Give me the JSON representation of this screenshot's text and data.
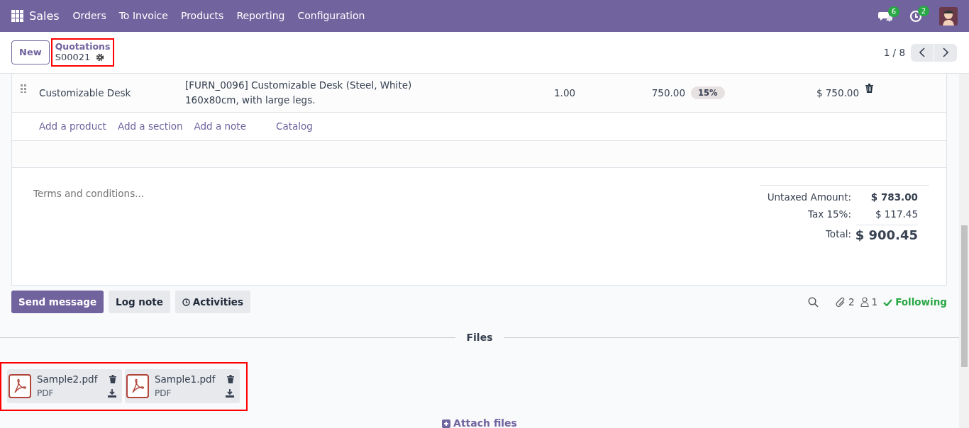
{
  "navbar": {
    "app": "Sales",
    "menus": [
      "Orders",
      "To Invoice",
      "Products",
      "Reporting",
      "Configuration"
    ],
    "messages_count": "6",
    "activities_count": "2"
  },
  "control_panel": {
    "new_button": "New",
    "breadcrumb": {
      "parent": "Quotations",
      "current": "S00021",
      "highlighted": true
    },
    "pager": "1 / 8"
  },
  "order_lines": [
    {
      "product": "Customizable Desk",
      "description": "[FURN_0096] Customizable Desk (Steel, White)\n160x80cm, with large legs.",
      "quantity": "1.00",
      "unit_price": "750.00",
      "tax": "15%",
      "subtotal": "$ 750.00"
    }
  ],
  "line_actions": [
    "Add a product",
    "Add a section",
    "Add a note",
    "Catalog"
  ],
  "terms": {
    "placeholder": "Terms and conditions..."
  },
  "totals": [
    {
      "label": "Untaxed Amount:",
      "value": "$ 783.00",
      "kind": "untaxed"
    },
    {
      "label": "Tax 15%:",
      "value": "$ 117.45",
      "kind": "tax"
    },
    {
      "label": "Total:",
      "value": "$ 900.45",
      "kind": "total"
    }
  ],
  "chatter": {
    "buttons": [
      {
        "label": "Send message",
        "selected": true
      },
      {
        "label": "Log note",
        "selected": false
      },
      {
        "label": "Activities",
        "selected": false
      }
    ],
    "attachments_count": "2",
    "followers_count": "1",
    "following": "Following"
  },
  "files": {
    "title": "Files",
    "highlighted": true,
    "items": [
      {
        "name": "Sample2.pdf",
        "type": "PDF"
      },
      {
        "name": "Sample1.pdf",
        "type": "PDF"
      }
    ],
    "attach": "Attach files"
  }
}
